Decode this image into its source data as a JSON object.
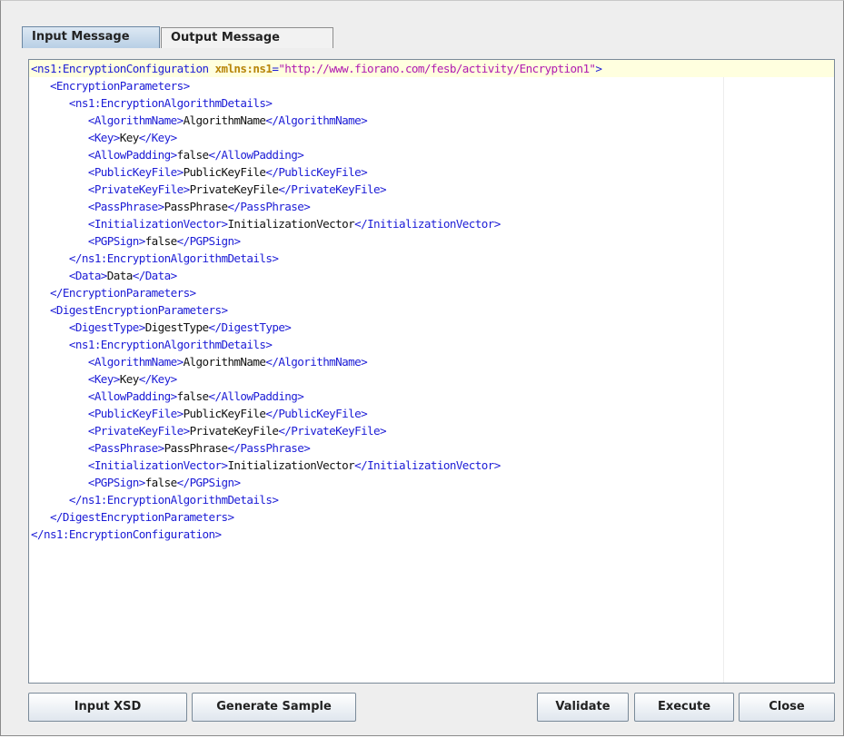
{
  "tabs": [
    {
      "label": "Input Message",
      "active": true
    },
    {
      "label": "Output Message",
      "active": false
    }
  ],
  "colors": {
    "tag": "#1c1cd6",
    "attribute_name": "#b8860b",
    "attribute_value": "#b01ab0",
    "text": "#111111",
    "current_line_highlight": "#ffffdf",
    "active_tab": "#b8cfe5"
  },
  "editor": {
    "lines": [
      {
        "segments": [
          {
            "t": "tag",
            "v": "<ns1:EncryptionConfiguration "
          },
          {
            "t": "attr-name",
            "v": "xmlns:ns1"
          },
          {
            "t": "tag",
            "v": "="
          },
          {
            "t": "attr-val",
            "v": "\"http://www.fiorano.com/fesb/activity/Encryption1\""
          },
          {
            "t": "tag",
            "v": ">"
          }
        ]
      },
      {
        "segments": [
          {
            "t": "tag",
            "v": "   <EncryptionParameters>"
          }
        ]
      },
      {
        "segments": [
          {
            "t": "tag",
            "v": "      <ns1:EncryptionAlgorithmDetails>"
          }
        ]
      },
      {
        "segments": [
          {
            "t": "tag",
            "v": "         <AlgorithmName>"
          },
          {
            "t": "txt",
            "v": "AlgorithmName"
          },
          {
            "t": "tag",
            "v": "</AlgorithmName>"
          }
        ]
      },
      {
        "segments": [
          {
            "t": "tag",
            "v": "         <Key>"
          },
          {
            "t": "txt",
            "v": "Key"
          },
          {
            "t": "tag",
            "v": "</Key>"
          }
        ]
      },
      {
        "segments": [
          {
            "t": "tag",
            "v": "         <AllowPadding>"
          },
          {
            "t": "txt",
            "v": "false"
          },
          {
            "t": "tag",
            "v": "</AllowPadding>"
          }
        ]
      },
      {
        "segments": [
          {
            "t": "tag",
            "v": "         <PublicKeyFile>"
          },
          {
            "t": "txt",
            "v": "PublicKeyFile"
          },
          {
            "t": "tag",
            "v": "</PublicKeyFile>"
          }
        ]
      },
      {
        "segments": [
          {
            "t": "tag",
            "v": "         <PrivateKeyFile>"
          },
          {
            "t": "txt",
            "v": "PrivateKeyFile"
          },
          {
            "t": "tag",
            "v": "</PrivateKeyFile>"
          }
        ]
      },
      {
        "segments": [
          {
            "t": "tag",
            "v": "         <PassPhrase>"
          },
          {
            "t": "txt",
            "v": "PassPhrase"
          },
          {
            "t": "tag",
            "v": "</PassPhrase>"
          }
        ]
      },
      {
        "segments": [
          {
            "t": "tag",
            "v": "         <InitializationVector>"
          },
          {
            "t": "txt",
            "v": "InitializationVector"
          },
          {
            "t": "tag",
            "v": "</InitializationVector>"
          }
        ]
      },
      {
        "segments": [
          {
            "t": "tag",
            "v": "         <PGPSign>"
          },
          {
            "t": "txt",
            "v": "false"
          },
          {
            "t": "tag",
            "v": "</PGPSign>"
          }
        ]
      },
      {
        "segments": [
          {
            "t": "tag",
            "v": "      </ns1:EncryptionAlgorithmDetails>"
          }
        ]
      },
      {
        "segments": [
          {
            "t": "tag",
            "v": "      <Data>"
          },
          {
            "t": "txt",
            "v": "Data"
          },
          {
            "t": "tag",
            "v": "</Data>"
          }
        ]
      },
      {
        "segments": [
          {
            "t": "tag",
            "v": "   </EncryptionParameters>"
          }
        ]
      },
      {
        "segments": [
          {
            "t": "tag",
            "v": "   <DigestEncryptionParameters>"
          }
        ]
      },
      {
        "segments": [
          {
            "t": "tag",
            "v": "      <DigestType>"
          },
          {
            "t": "txt",
            "v": "DigestType"
          },
          {
            "t": "tag",
            "v": "</DigestType>"
          }
        ]
      },
      {
        "segments": [
          {
            "t": "tag",
            "v": "      <ns1:EncryptionAlgorithmDetails>"
          }
        ]
      },
      {
        "segments": [
          {
            "t": "tag",
            "v": "         <AlgorithmName>"
          },
          {
            "t": "txt",
            "v": "AlgorithmName"
          },
          {
            "t": "tag",
            "v": "</AlgorithmName>"
          }
        ]
      },
      {
        "segments": [
          {
            "t": "tag",
            "v": "         <Key>"
          },
          {
            "t": "txt",
            "v": "Key"
          },
          {
            "t": "tag",
            "v": "</Key>"
          }
        ]
      },
      {
        "segments": [
          {
            "t": "tag",
            "v": "         <AllowPadding>"
          },
          {
            "t": "txt",
            "v": "false"
          },
          {
            "t": "tag",
            "v": "</AllowPadding>"
          }
        ]
      },
      {
        "segments": [
          {
            "t": "tag",
            "v": "         <PublicKeyFile>"
          },
          {
            "t": "txt",
            "v": "PublicKeyFile"
          },
          {
            "t": "tag",
            "v": "</PublicKeyFile>"
          }
        ]
      },
      {
        "segments": [
          {
            "t": "tag",
            "v": "         <PrivateKeyFile>"
          },
          {
            "t": "txt",
            "v": "PrivateKeyFile"
          },
          {
            "t": "tag",
            "v": "</PrivateKeyFile>"
          }
        ]
      },
      {
        "segments": [
          {
            "t": "tag",
            "v": "         <PassPhrase>"
          },
          {
            "t": "txt",
            "v": "PassPhrase"
          },
          {
            "t": "tag",
            "v": "</PassPhrase>"
          }
        ]
      },
      {
        "segments": [
          {
            "t": "tag",
            "v": "         <InitializationVector>"
          },
          {
            "t": "txt",
            "v": "InitializationVector"
          },
          {
            "t": "tag",
            "v": "</InitializationVector>"
          }
        ]
      },
      {
        "segments": [
          {
            "t": "tag",
            "v": "         <PGPSign>"
          },
          {
            "t": "txt",
            "v": "false"
          },
          {
            "t": "tag",
            "v": "</PGPSign>"
          }
        ]
      },
      {
        "segments": [
          {
            "t": "tag",
            "v": "      </ns1:EncryptionAlgorithmDetails>"
          }
        ]
      },
      {
        "segments": [
          {
            "t": "tag",
            "v": "   </DigestEncryptionParameters>"
          }
        ]
      },
      {
        "segments": [
          {
            "t": "tag",
            "v": "</ns1:EncryptionConfiguration>"
          }
        ]
      }
    ]
  },
  "buttons": {
    "input_xsd": "Input XSD",
    "generate_sample": "Generate Sample",
    "validate": "Validate",
    "execute": "Execute",
    "close": "Close"
  }
}
